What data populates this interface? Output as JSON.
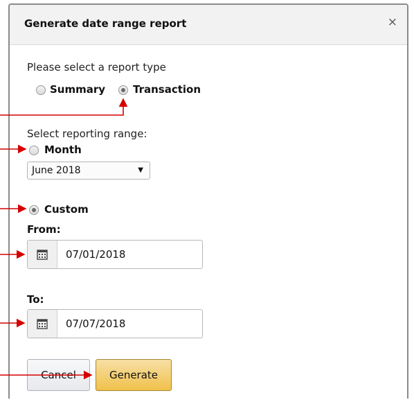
{
  "dialog": {
    "title": "Generate date range report",
    "close": "×"
  },
  "report_type": {
    "prompt": "Please select a report type",
    "options": [
      {
        "label": "Summary",
        "selected": false
      },
      {
        "label": "Transaction",
        "selected": true
      }
    ]
  },
  "range": {
    "prompt": "Select reporting range:",
    "month": {
      "label": "Month",
      "selected": false,
      "value": "June 2018"
    },
    "custom": {
      "label": "Custom",
      "selected": true
    },
    "from": {
      "label": "From:",
      "value": "07/01/2018"
    },
    "to": {
      "label": "To:",
      "value": "07/07/2018"
    }
  },
  "buttons": {
    "cancel": "Cancel",
    "generate": "Generate"
  },
  "colors": {
    "annotation_arrow": "#d40000",
    "generate_button": "#f0c14b"
  }
}
